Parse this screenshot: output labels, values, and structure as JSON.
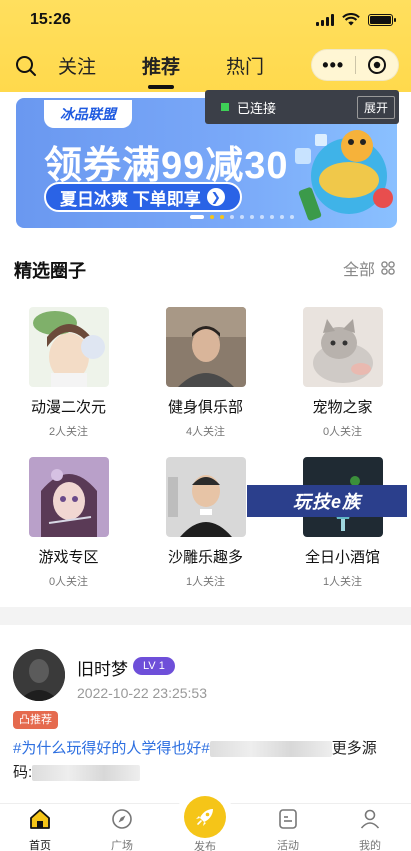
{
  "status": {
    "time": "15:26"
  },
  "nav": {
    "tabs": [
      {
        "label": "关注"
      },
      {
        "label": "推荐"
      },
      {
        "label": "热门"
      }
    ],
    "capsule_more": "•••"
  },
  "connection": {
    "status": "已连接",
    "expand": "展开"
  },
  "banner": {
    "logo": "冰品联盟",
    "headline": "领券满99减30",
    "subline": "夏日冰爽 下单即享",
    "arrow": "❯"
  },
  "circles": {
    "title": "精选圈子",
    "all_label": "全部",
    "items": [
      {
        "name": "动漫二次元",
        "count": "2人关注"
      },
      {
        "name": "健身俱乐部",
        "count": "4人关注"
      },
      {
        "name": "宠物之家",
        "count": "0人关注"
      },
      {
        "name": "游戏专区",
        "count": "0人关注"
      },
      {
        "name": "沙雕乐趣多",
        "count": "1人关注"
      },
      {
        "name": "全日小酒馆",
        "count": "1人关注"
      }
    ],
    "overlay_text": "玩技e族"
  },
  "post": {
    "username": "旧时梦",
    "level": "LV 1",
    "time": "2022-10-22 23:25:53",
    "badge": "凸推荐",
    "tag": "#为什么玩得好的人学得也好#",
    "text_after": "更多源",
    "text_line2": "码:"
  },
  "tabbar": {
    "items": [
      {
        "label": "首页"
      },
      {
        "label": "广场"
      },
      {
        "label": "发布"
      },
      {
        "label": "活动"
      },
      {
        "label": "我的"
      }
    ]
  },
  "colors": {
    "accent_yellow": "#ffd94c",
    "level_purple": "#6e4fd9",
    "tag_blue": "#2d6fe0",
    "badge_orange": "#e56a4e",
    "connected_green": "#3ed157"
  }
}
